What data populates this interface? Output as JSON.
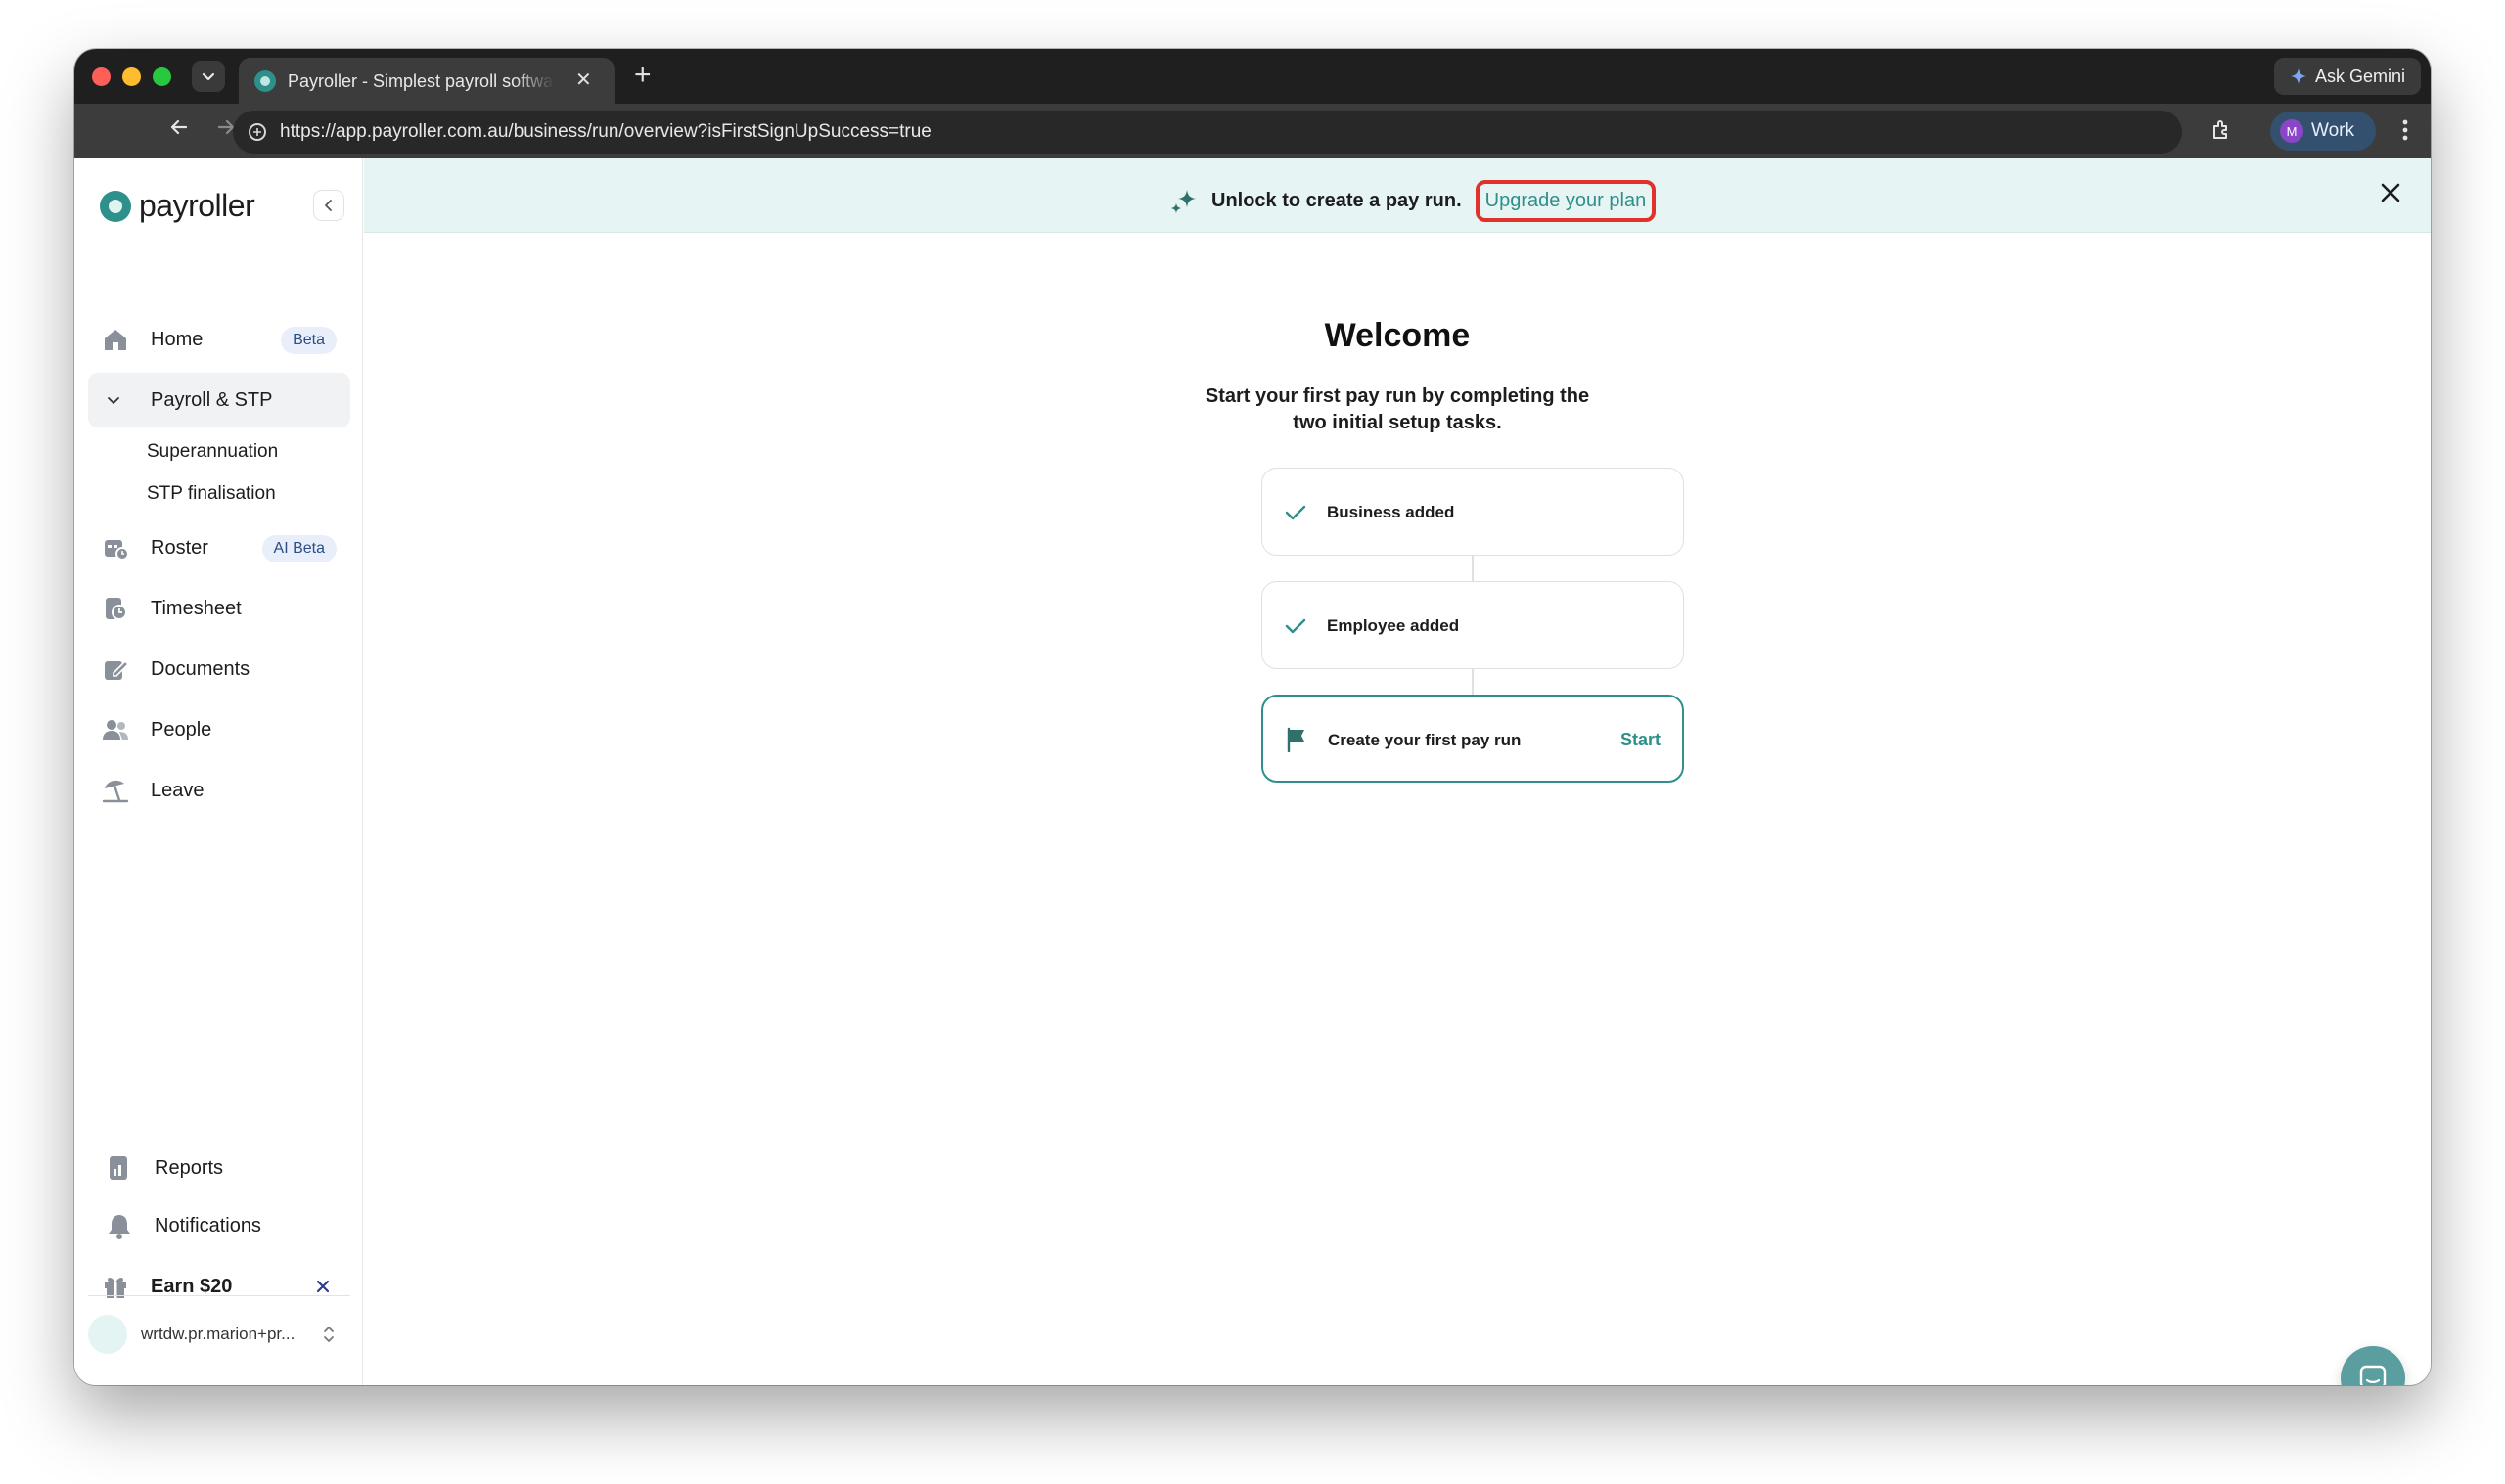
{
  "browser": {
    "tab_title": "Payroller - Simplest payroll software",
    "tab_close": "✕",
    "new_tab": "+",
    "url": "https://app.payroller.com.au/business/run/overview?isFirstSignUpSuccess=true",
    "gemini_label": "Ask Gemini",
    "profile_initial": "M",
    "profile_label": "Work"
  },
  "sidebar": {
    "logo_text": "payroller",
    "items": [
      {
        "label": "Home",
        "badge": "Beta"
      },
      {
        "label": "Payroll & STP"
      },
      {
        "label": "Roster",
        "badge": "AI Beta"
      },
      {
        "label": "Timesheet"
      },
      {
        "label": "Documents"
      },
      {
        "label": "People"
      },
      {
        "label": "Leave"
      }
    ],
    "payroll_subitems": [
      "Superannuation",
      "STP finalisation"
    ],
    "bottom_items": [
      {
        "label": "Reports"
      },
      {
        "label": "Notifications"
      },
      {
        "label": "Earn $20"
      }
    ],
    "user_name": "wrtdw.pr.marion+pr..."
  },
  "banner": {
    "text": "Unlock to create a pay run.",
    "link": "Upgrade your plan"
  },
  "main": {
    "title": "Welcome",
    "subtitle": "Start your first pay run by completing the two initial setup tasks.",
    "steps": [
      {
        "label": "Business added",
        "status": "done"
      },
      {
        "label": "Employee added",
        "status": "done"
      },
      {
        "label": "Create your first pay run",
        "action": "Start"
      }
    ]
  },
  "colors": {
    "brand": "#2f8f8a",
    "banner_bg": "#e6f4f4",
    "highlight_ring": "#e0322b"
  }
}
